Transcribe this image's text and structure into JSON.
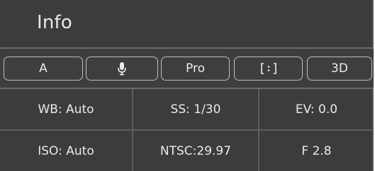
{
  "panel": {
    "title": "Info"
  },
  "toolbar": {
    "buttons": [
      {
        "label": "A"
      },
      {
        "icon": "microphone-icon"
      },
      {
        "label": "Pro"
      },
      {
        "label": "[∘]",
        "icon": "frame-icon"
      },
      {
        "label": "3D"
      }
    ]
  },
  "info_grid": {
    "rows": [
      [
        "WB: Auto",
        "SS: 1/30",
        "EV: 0.0"
      ],
      [
        "ISO: Auto",
        "NTSC:29.97",
        "F 2.8"
      ]
    ]
  },
  "colors": {
    "panel_bg": "#3c3c3c",
    "text": "#eaeaea",
    "button_border": "#bdbdbd",
    "divider": "#5e5e5e"
  }
}
